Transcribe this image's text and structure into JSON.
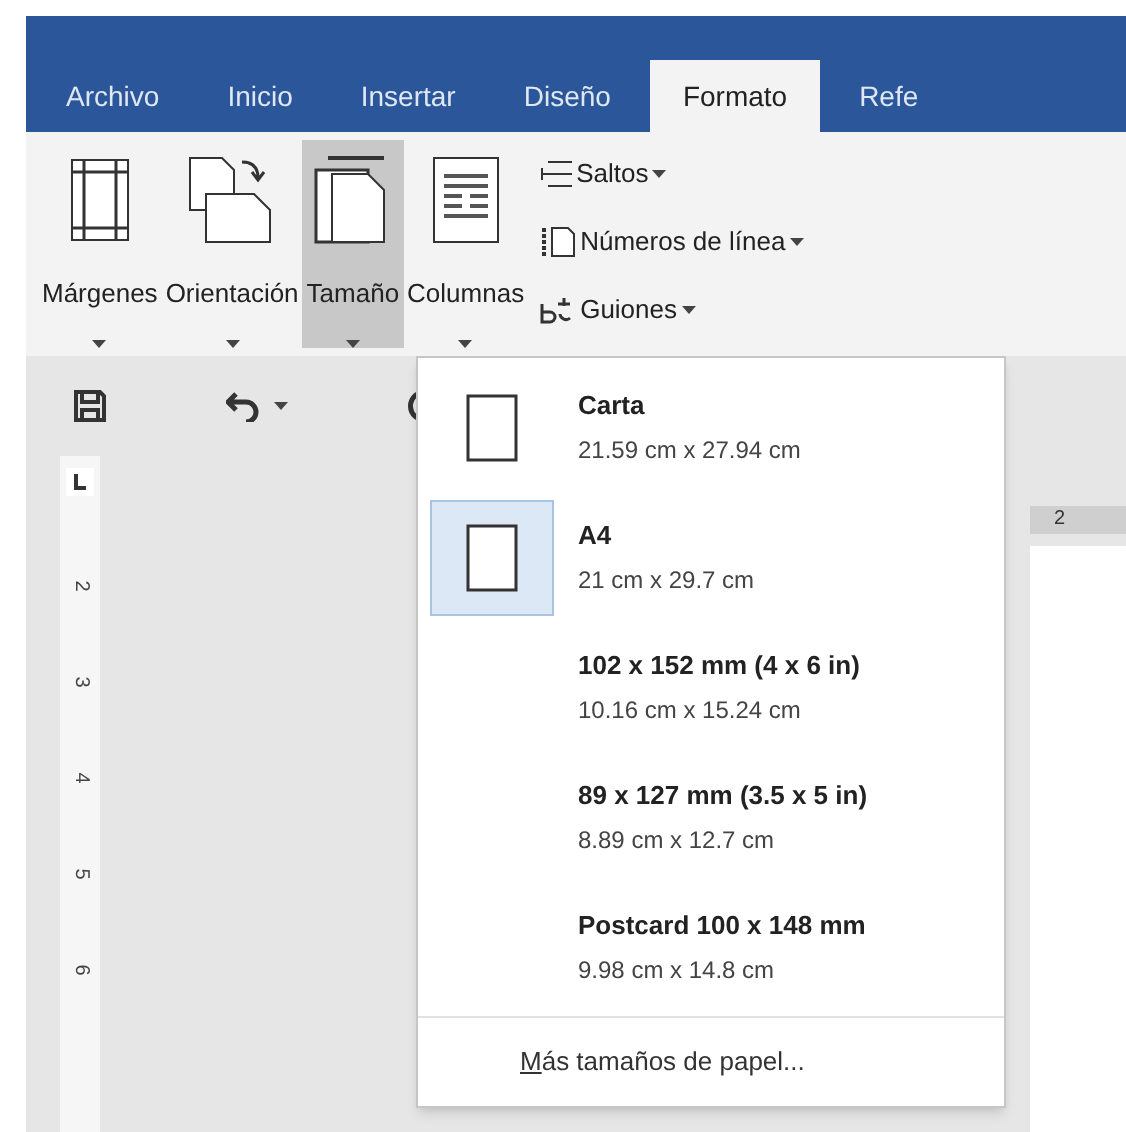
{
  "tabs": [
    {
      "label": "Archivo",
      "selected": false
    },
    {
      "label": "Inicio",
      "selected": false
    },
    {
      "label": "Insertar",
      "selected": false
    },
    {
      "label": "Diseño",
      "selected": false
    },
    {
      "label": "Formato",
      "selected": true
    },
    {
      "label": "Refe",
      "selected": false
    }
  ],
  "ribbon": {
    "large_buttons": [
      {
        "kind": "margins",
        "label": "Márgenes",
        "pressed": false
      },
      {
        "kind": "orientation",
        "label": "Orientación",
        "pressed": false
      },
      {
        "kind": "size",
        "label": "Tamaño",
        "pressed": true
      },
      {
        "kind": "columns",
        "label": "Columnas",
        "pressed": false
      }
    ],
    "small_buttons": [
      {
        "kind": "breaks",
        "label": "Saltos"
      },
      {
        "kind": "line-numbers",
        "label": "Números de línea"
      },
      {
        "kind": "hyphenation",
        "label": "Guiones"
      }
    ]
  },
  "size_menu": {
    "items": [
      {
        "kind": "with-icon",
        "title": "Carta",
        "subtitle": "21.59 cm x 27.94 cm",
        "selected": false
      },
      {
        "kind": "with-icon",
        "title": "A4",
        "subtitle": "21 cm x 29.7 cm",
        "selected": true
      },
      {
        "kind": "plain",
        "title": "102 x 152 mm (4 x 6 in)",
        "subtitle": "10.16 cm x 15.24 cm",
        "selected": false
      },
      {
        "kind": "plain",
        "title": "89 x 127 mm (3.5 x 5 in)",
        "subtitle": "8.89 cm x 12.7 cm",
        "selected": false
      },
      {
        "kind": "plain",
        "title": "Postcard 100 x 148 mm",
        "subtitle": "9.98 cm x 14.8 cm",
        "selected": false
      }
    ],
    "more": {
      "access_key": "M",
      "rest": "ás tamaños de papel..."
    }
  },
  "vertical_ruler": {
    "labels": [
      "2",
      "3",
      "4",
      "5",
      "6"
    ]
  },
  "horizontal_ruler": {
    "labels": [
      "2"
    ]
  }
}
